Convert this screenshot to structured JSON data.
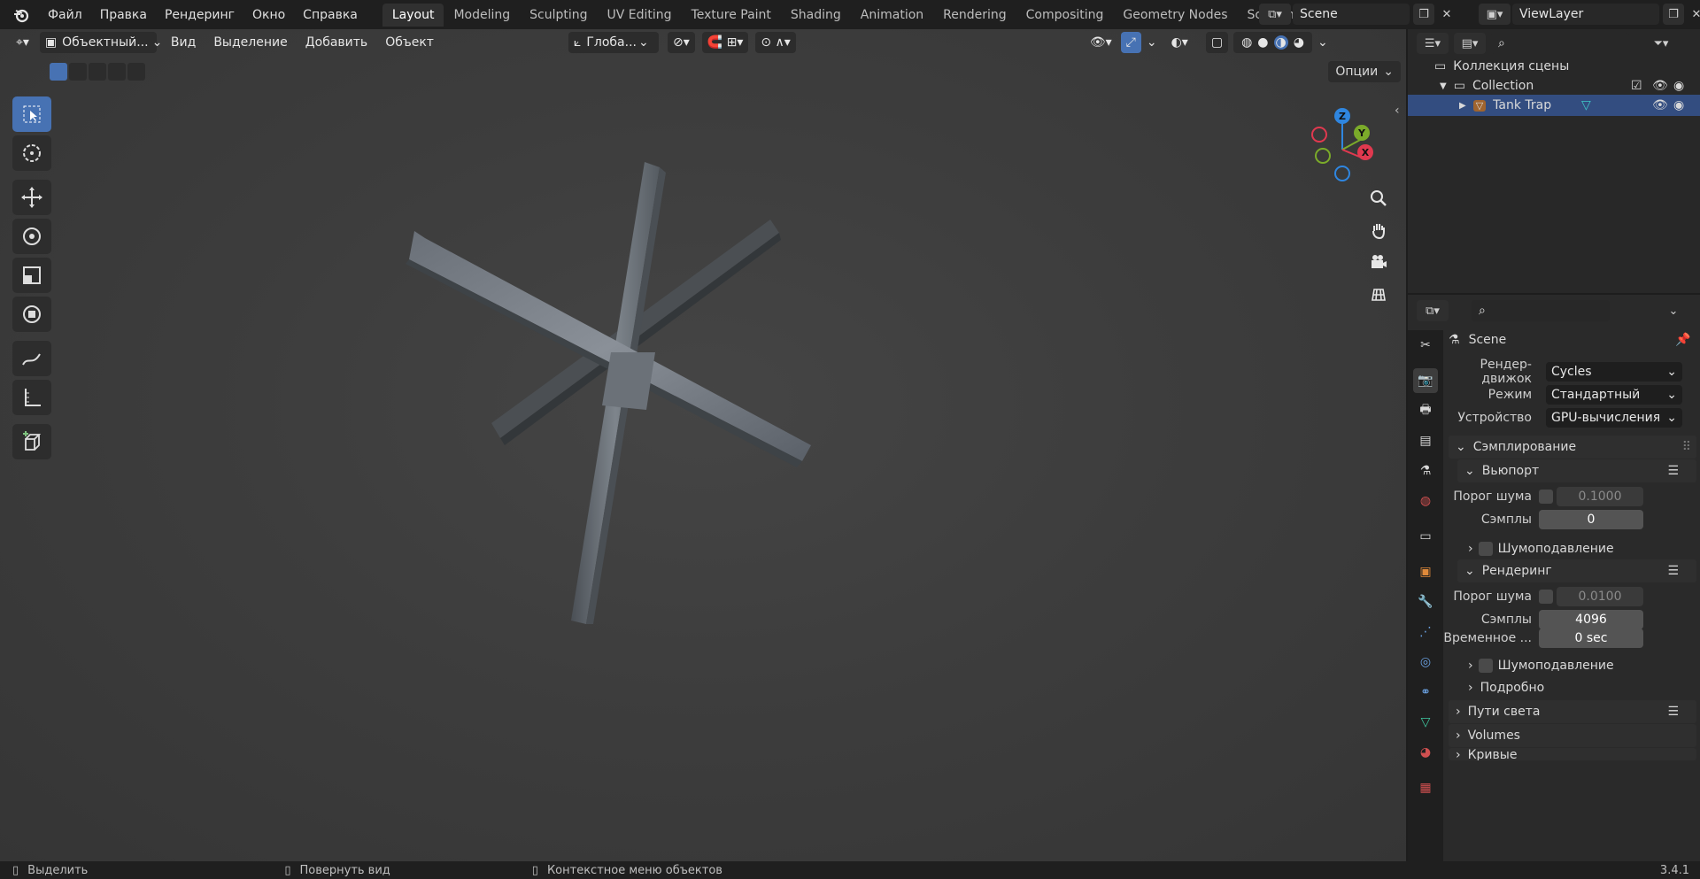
{
  "menu": [
    "Файл",
    "Правка",
    "Рендеринг",
    "Окно",
    "Справка"
  ],
  "workspaces": [
    "Layout",
    "Modeling",
    "Sculpting",
    "UV Editing",
    "Texture Paint",
    "Shading",
    "Animation",
    "Rendering",
    "Compositing",
    "Geometry Nodes",
    "Scripting"
  ],
  "active_workspace": "Layout",
  "scene_name": "Scene",
  "view_layer": "ViewLayer",
  "viewport": {
    "mode": "Объектный...",
    "menus": [
      "Вид",
      "Выделение",
      "Добавить",
      "Объект"
    ],
    "orientation": "Глоба...",
    "options_label": "Опции"
  },
  "gizmo": {
    "x": "X",
    "y": "Y",
    "z": "Z"
  },
  "outliner": {
    "root": "Коллекция сцены",
    "collection": "Collection",
    "object": "Tank Trap"
  },
  "properties": {
    "scene_header": "Scene",
    "render_engine_label": "Рендер-движок",
    "render_engine": "Cycles",
    "mode_label": "Режим",
    "mode": "Стандартный",
    "device_label": "Устройство",
    "device": "GPU-вычисления",
    "sampling": "Сэмплирование",
    "viewport_panel": "Вьюпорт",
    "noise_threshold_label": "Порог шума",
    "viewport_noise_threshold": "0.1000",
    "samples_label": "Сэмплы",
    "viewport_samples": "0",
    "denoise_label": "Шумоподавление",
    "render_panel": "Рендеринг",
    "render_noise_threshold": "0.0100",
    "render_samples": "4096",
    "time_limit_label": "Временное ...",
    "time_limit": "0 sec",
    "advanced": "Подробно",
    "light_paths": "Пути света",
    "volumes": "Volumes",
    "curves": "Кривые"
  },
  "status": {
    "select": "Выделить",
    "rotate": "Повернуть вид",
    "context_menu": "Контекстное меню объектов",
    "version": "3.4.1"
  },
  "colors": {
    "accent": "#4772b3",
    "selected_row": "#334d80",
    "axis_x": "#e0394f",
    "axis_y": "#7bab2a",
    "axis_z": "#2f86e0"
  }
}
